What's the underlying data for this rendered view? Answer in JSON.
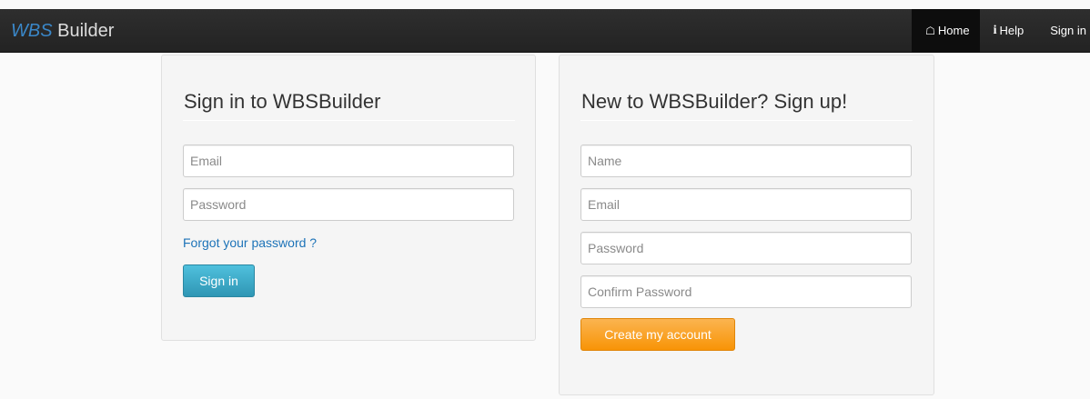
{
  "navbar": {
    "brand_prefix": "WBS",
    "brand_suffix": " Builder",
    "items": [
      {
        "label": "Home",
        "icon": "home-icon",
        "active": true
      },
      {
        "label": "Help",
        "icon": "info-icon",
        "active": false
      },
      {
        "label": "Sign in",
        "icon": null,
        "active": false
      }
    ]
  },
  "signin": {
    "title": "Sign in to WBSBuilder",
    "email_placeholder": "Email",
    "password_placeholder": "Password",
    "forgot_link": "Forgot your password ?",
    "submit_label": "Sign in"
  },
  "signup": {
    "title": "New to WBSBuilder? Sign up!",
    "name_placeholder": "Name",
    "email_placeholder": "Email",
    "password_placeholder": "Password",
    "confirm_placeholder": "Confirm Password",
    "submit_label": "Create my account"
  },
  "colors": {
    "navbar": "#2b2b2b",
    "brand_accent": "#3a87c8",
    "signin_button": "#2f96b4",
    "signup_button": "#f89406",
    "link": "#1d73b8"
  }
}
